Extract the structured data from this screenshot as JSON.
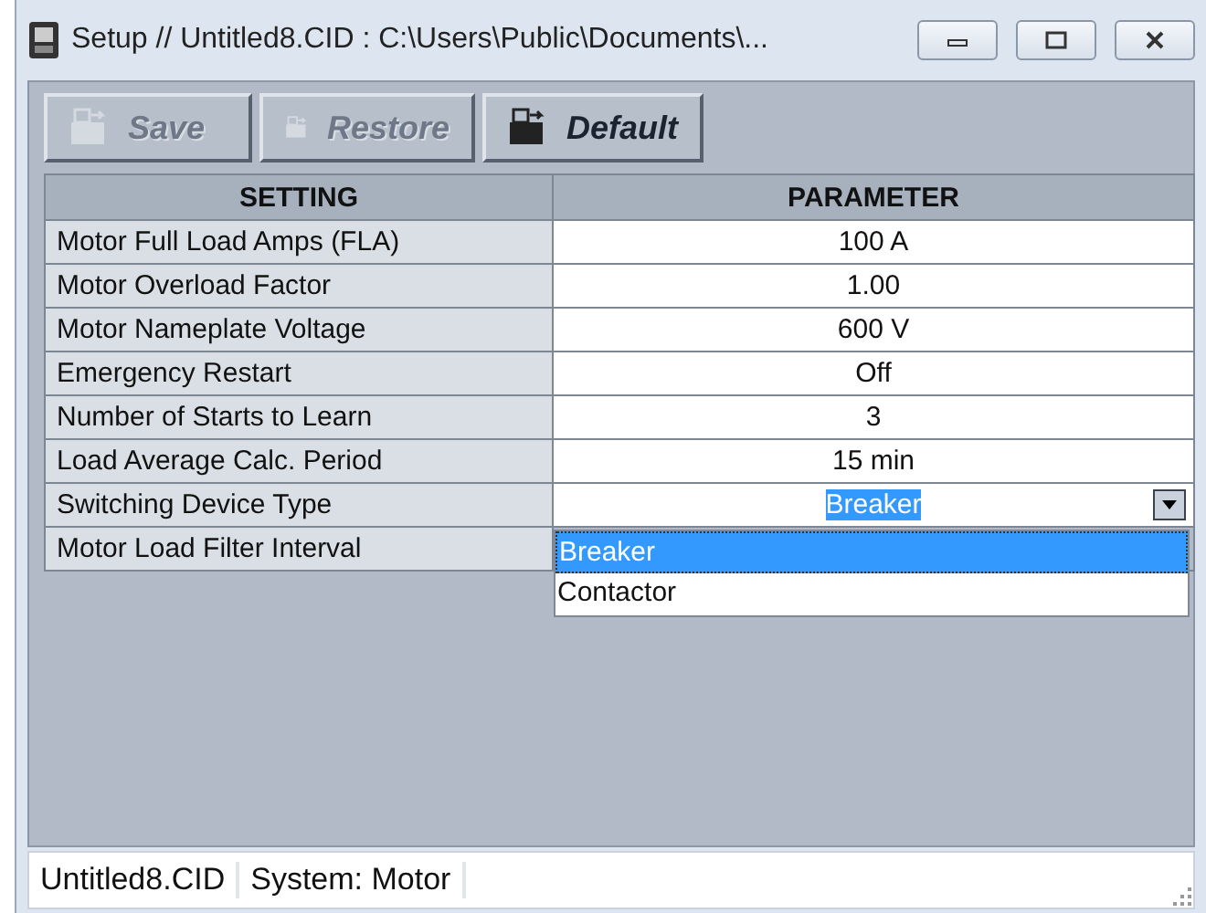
{
  "window": {
    "title": "Setup // Untitled8.CID : C:\\Users\\Public\\Documents\\..."
  },
  "toolbar": [
    {
      "label": "Save",
      "disabled": true
    },
    {
      "label": "Restore",
      "disabled": true
    },
    {
      "label": "Default",
      "disabled": false
    }
  ],
  "table": {
    "columns": [
      "SETTING",
      "PARAMETER"
    ],
    "rows": [
      {
        "kind": "text",
        "setting": "Motor Full Load Amps (FLA)",
        "parameter": "100 A"
      },
      {
        "kind": "text",
        "setting": "Motor Overload Factor",
        "parameter": "1.00"
      },
      {
        "kind": "text",
        "setting": "Motor Nameplate Voltage",
        "parameter": "600 V"
      },
      {
        "kind": "text",
        "setting": "Emergency Restart",
        "parameter": "Off"
      },
      {
        "kind": "text",
        "setting": "Number of Starts to Learn",
        "parameter": "3"
      },
      {
        "kind": "text",
        "setting": "Load Average Calc. Period",
        "parameter": "15 min"
      },
      {
        "kind": "dropdown",
        "setting": "Switching Device Type",
        "parameter": "Breaker",
        "expanded": true,
        "options": [
          {
            "label": "Breaker",
            "selected": true
          },
          {
            "label": "Contactor",
            "selected": false
          }
        ]
      },
      {
        "kind": "covered",
        "setting": "Motor Load Filter Interval"
      }
    ]
  },
  "status_bar": [
    "Untitled8.CID",
    "System: Motor"
  ]
}
